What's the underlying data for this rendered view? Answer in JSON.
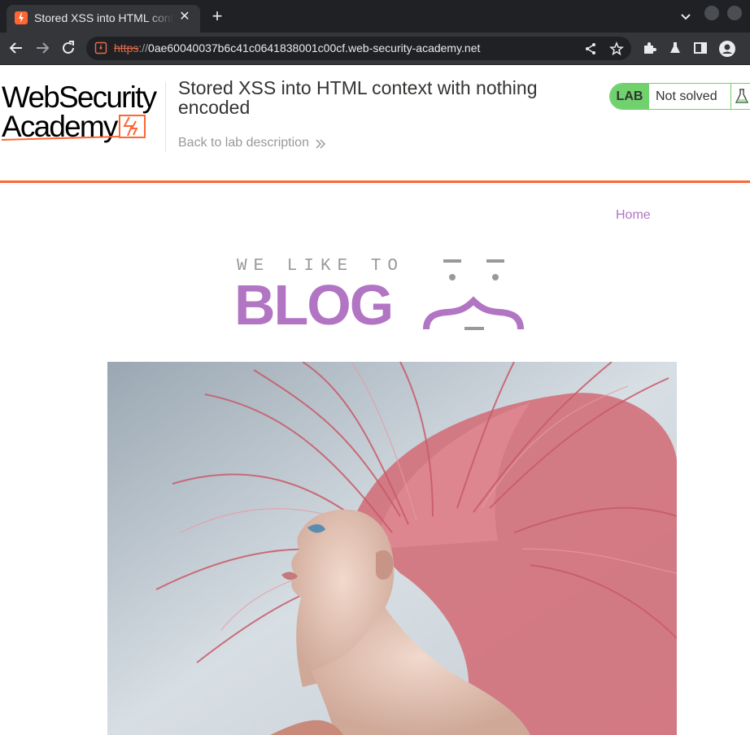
{
  "browser": {
    "tab_title": "Stored XSS into HTML context with nothing encoded",
    "tab_close": "✕",
    "new_tab": "+",
    "url_scheme": "https",
    "url_separator": "://",
    "url_host": "0ae60040037b6c41c0641838001c00cf.web-security-academy.net",
    "accent_color": "#ff6633"
  },
  "academy": {
    "logo_line1": "WebSecurity",
    "logo_line2": "Academy",
    "lab_title": "Stored XSS into HTML context with nothing encoded",
    "back_link": "Back to lab description",
    "lab_badge": "LAB",
    "lab_status": "Not solved",
    "status_color": "#70d16d"
  },
  "blog": {
    "nav_home": "Home",
    "banner_tagline": "WE LIKE TO",
    "banner_title": "BLOG",
    "brand_color": "#b175c4"
  },
  "icons": [
    "back-arrow-icon",
    "forward-arrow-icon",
    "reload-icon",
    "site-info-icon",
    "share-icon",
    "star-icon",
    "extensions-icon",
    "labs-flask-icon",
    "side-panel-icon",
    "profile-icon",
    "chevron-double-right-icon",
    "flask-icon"
  ]
}
